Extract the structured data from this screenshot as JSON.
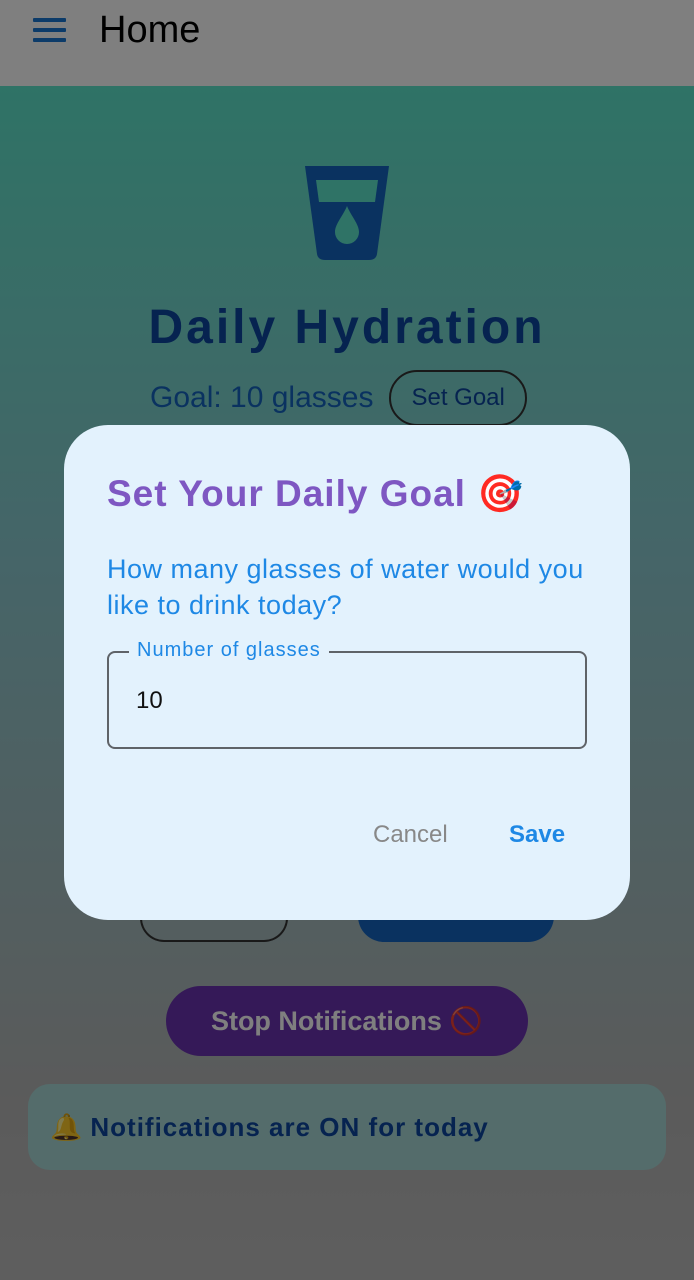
{
  "appbar": {
    "title": "Home",
    "menu_icon": "hamburger-menu-icon"
  },
  "hero": {
    "icon": "water-glass-icon",
    "heading": "Daily Hydration"
  },
  "goal": {
    "text": "Goal: 10 glasses",
    "set_goal_label": "Set Goal"
  },
  "actions": {
    "stop_label": "Stop Notifications 🚫"
  },
  "notification": {
    "bell": "🔔",
    "text": "Notifications are ON for today"
  },
  "dialog": {
    "title": "Set Your Daily Goal 🎯",
    "message": "How many glasses of water would you like to drink today?",
    "field_label": "Number of glasses",
    "field_value": "10",
    "cancel_label": "Cancel",
    "save_label": "Save"
  },
  "colors": {
    "accent": "#1976d2",
    "heading": "#0d47a1",
    "dialog_title": "#7e57c2",
    "stop_button": "#6b33b0",
    "dialog_bg": "#e3f2fd"
  }
}
